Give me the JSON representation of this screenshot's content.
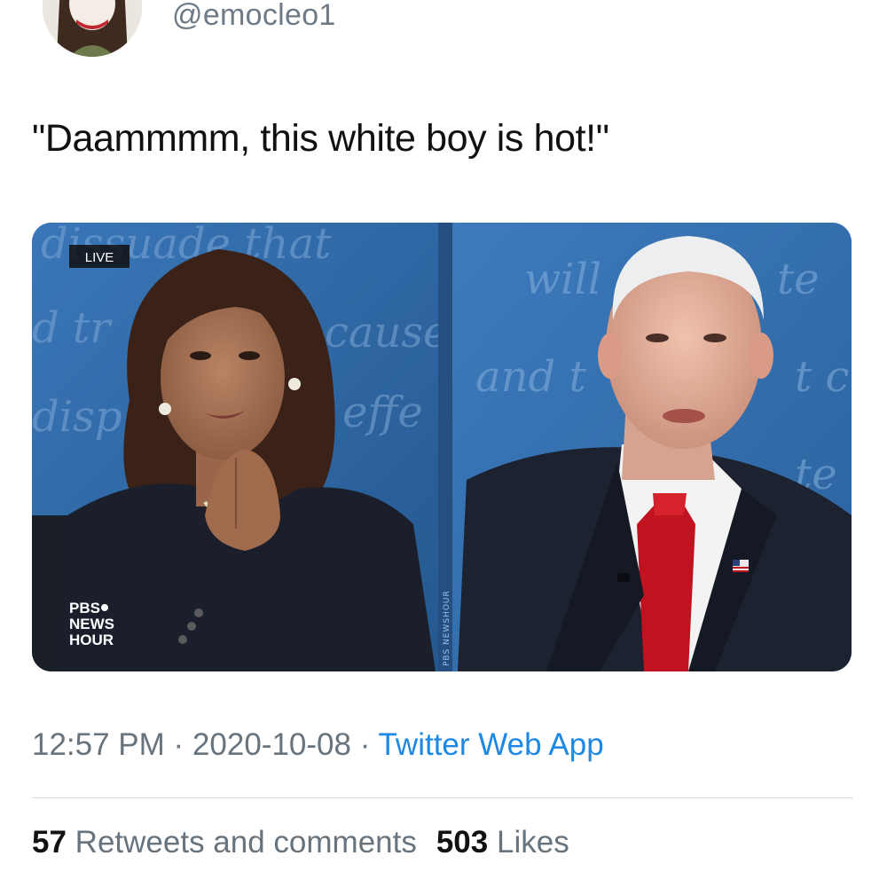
{
  "tweet": {
    "handle": "@emocleo1",
    "text": "\"Daammmm, this white boy is hot!\"",
    "time": "12:57 PM",
    "sep1": "·",
    "date": "2020-10-08",
    "sep2": "·",
    "source": "Twitter Web App",
    "retweets_count": "57",
    "retweets_label": "Retweets and comments",
    "likes_count": "503",
    "likes_label": "Likes"
  },
  "media": {
    "live_badge": "LIVE",
    "broadcaster_logo": [
      "PBS",
      "NEWS",
      "HOUR"
    ],
    "divider_watermark": "PBS NEWSHOUR",
    "backdrop_text_left": [
      "dissuade that",
      "d tr",
      "cause",
      "disp",
      "effe"
    ],
    "backdrop_text_right": [
      "will",
      "te",
      "and t",
      "t c",
      "te s"
    ]
  },
  "colors": {
    "backdrop_blue": "#2d67a9",
    "tie_red": "#c1121f",
    "link_blue": "#1e88e5",
    "meta_gray": "#67737d"
  }
}
